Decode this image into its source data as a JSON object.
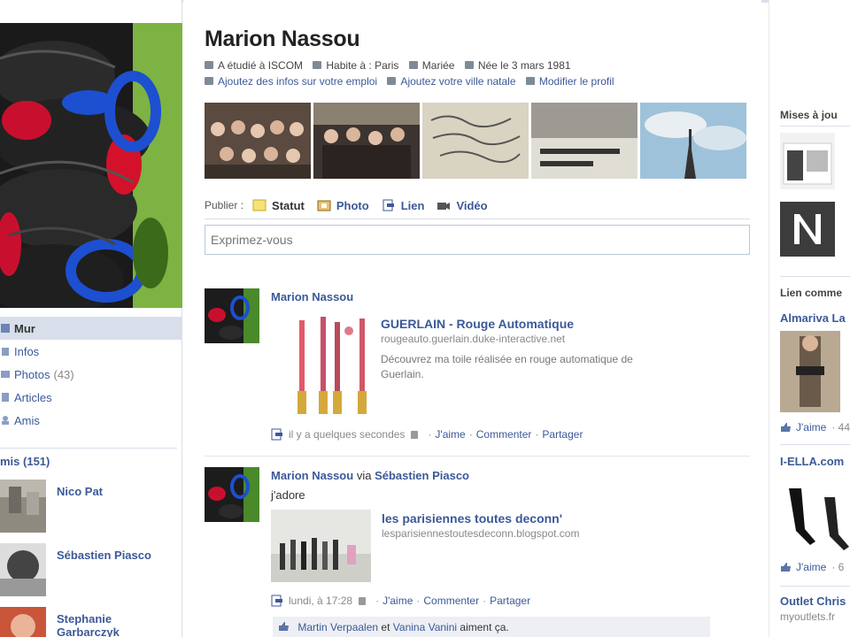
{
  "profile": {
    "name": "Marion Nassou",
    "info": [
      {
        "icon": "education-icon",
        "text": "A étudié à ISCOM"
      },
      {
        "icon": "home-icon",
        "text": "Habite à : Paris"
      },
      {
        "icon": "heart-icon",
        "text": "Mariée"
      },
      {
        "icon": "calendar-icon",
        "text": "Née le 3 mars 1981"
      },
      {
        "icon": "briefcase-icon",
        "text": "Ajoutez des infos sur votre emploi"
      },
      {
        "icon": "house-icon",
        "text": "Ajoutez votre ville natale"
      },
      {
        "icon": "pencil-icon",
        "text": "Modifier le profil"
      }
    ]
  },
  "nav": {
    "items": [
      {
        "label": "Mur",
        "count": "",
        "icon": "wall-icon"
      },
      {
        "label": "Infos",
        "count": "",
        "icon": "info-icon"
      },
      {
        "label": "Photos",
        "count": "(43)",
        "icon": "photos-icon"
      },
      {
        "label": "Articles",
        "count": "",
        "icon": "notes-icon"
      },
      {
        "label": "Amis",
        "count": "",
        "icon": "friends-icon"
      }
    ]
  },
  "friends": {
    "heading": "mis (151)",
    "list": [
      {
        "name": "Nico Pat"
      },
      {
        "name": "Sébastien Piasco"
      },
      {
        "name": "Stephanie Garbarczyk"
      }
    ]
  },
  "publisher": {
    "label": "Publier :",
    "options": [
      {
        "label": "Statut",
        "icon": "status-icon"
      },
      {
        "label": "Photo",
        "icon": "photo-icon"
      },
      {
        "label": "Lien",
        "icon": "link-icon"
      },
      {
        "label": "Vidéo",
        "icon": "video-icon"
      }
    ],
    "placeholder": "Exprimez-vous"
  },
  "stories": [
    {
      "author": "Marion Nassou",
      "via": "",
      "via_name": "",
      "message": "",
      "link_title": "GUERLAIN - Rouge Automatique",
      "link_domain": "rougeauto.guerlain.duke-interactive.net",
      "link_desc": "Découvrez ma toile réalisée en rouge automatique de Guerlain.",
      "time": "il y a quelques secondes",
      "like": "J'aime",
      "comment": "Commenter",
      "share": "Partager"
    },
    {
      "author": "Marion Nassou",
      "via": "via",
      "via_name": "Sébastien Piasco",
      "message": "j'adore",
      "link_title": "les parisiennes toutes deconn'",
      "link_domain": "lesparisiennestoutesdeconn.blogspot.com",
      "link_desc": "",
      "time": "lundi, à 17:28",
      "like": "J'aime",
      "comment": "Commenter",
      "share": "Partager"
    }
  ],
  "likes_bar": {
    "person1": "Martin Verpaalen",
    "connector": "et",
    "person2": "Vanina Vanini",
    "suffix": "aiment ça."
  },
  "right": {
    "updates_heading": "Mises à jou",
    "sponsored_heading": "Lien comme",
    "ad1_title": "Almariva La",
    "ad1_like": "J'aime",
    "ad1_sub": "· 44",
    "ad2_title": "I-ELLA.com",
    "ad2_like": "J'aime",
    "ad2_sub": "· 6",
    "ad3_title": "Outlet Chris",
    "ad3_domain": "myoutlets.fr"
  },
  "colors": {
    "link": "#3b5998",
    "nav_active_bg": "#d8dfea",
    "likes_bg": "#edeff4"
  }
}
